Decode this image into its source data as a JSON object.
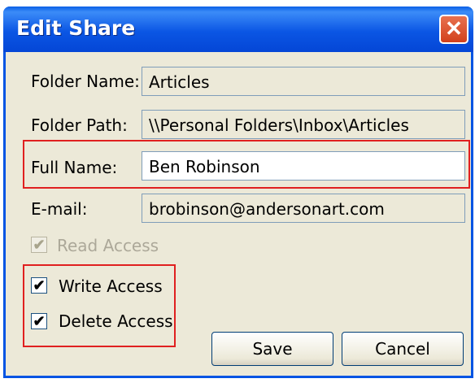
{
  "dialog": {
    "title": "Edit Share",
    "close_symbol": "✕"
  },
  "form": {
    "folder_name_label": "Folder Name:",
    "folder_name_value": "Articles",
    "folder_path_label": "Folder Path:",
    "folder_path_value": "\\\\Personal Folders\\Inbox\\Articles",
    "full_name_label": "Full Name:",
    "full_name_value": "Ben Robinson",
    "email_label": "E-mail:",
    "email_value": "brobinson@andersonart.com"
  },
  "permissions": {
    "read_label": "Read Access",
    "read_checked": true,
    "write_label": "Write Access",
    "write_checked": true,
    "delete_label": "Delete Access",
    "delete_checked": true,
    "check_mark": "✔"
  },
  "buttons": {
    "save": "Save",
    "cancel": "Cancel"
  }
}
